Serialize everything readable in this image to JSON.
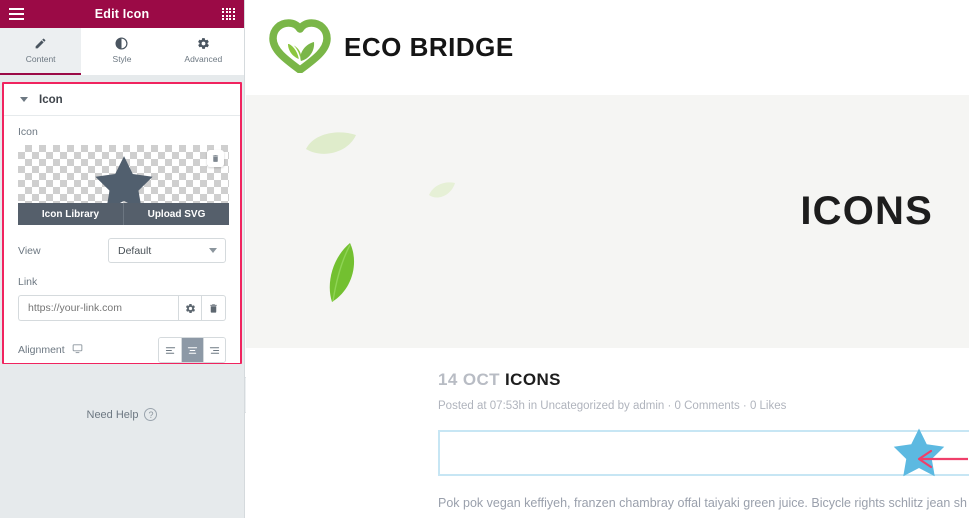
{
  "panel": {
    "header": {
      "title": "Edit Icon",
      "menu_icon": "hamburger-icon",
      "apps_icon": "grid-apps-icon"
    },
    "tabs": [
      {
        "label": "Content",
        "icon": "pencil-icon",
        "active": true
      },
      {
        "label": "Style",
        "icon": "contrast-half-circle-icon",
        "active": false
      },
      {
        "label": "Advanced",
        "icon": "gear-icon",
        "active": false
      }
    ],
    "section": {
      "title": "Icon",
      "collapse_icon": "caret-down-icon"
    },
    "controls": {
      "icon_field_label": "Icon",
      "media_delete_icon": "trash-icon",
      "icon_library_label": "Icon Library",
      "upload_svg_label": "Upload SVG",
      "view_label": "View",
      "view_value": "Default",
      "view_caret_icon": "caret-down-icon",
      "link_label": "Link",
      "link_placeholder": "https://your-link.com",
      "link_value": "",
      "link_settings_icon": "gear-icon",
      "link_delete_icon": "trash-icon",
      "alignment_label": "Alignment",
      "alignment_device_icon": "desktop-icon",
      "alignment_options": [
        {
          "name": "align-left",
          "icon": "align-left-icon",
          "active": false
        },
        {
          "name": "align-center",
          "icon": "align-center-icon",
          "active": true
        },
        {
          "name": "align-right",
          "icon": "align-right-icon",
          "active": false
        }
      ]
    },
    "footer": {
      "need_help_label": "Need Help",
      "help_icon_glyph": "?"
    },
    "collapse_handle_glyph": "‹"
  },
  "site": {
    "logo": {
      "icon": "eco-heart-leaf-logo",
      "text": "ECO BRIDGE"
    },
    "hero": {
      "title": "ICONS",
      "decor": "floating-leaves"
    },
    "post": {
      "date": "14 OCT",
      "title": "ICONS",
      "meta": "Posted at 07:53h in Uncategorized by admin · 0 Comments · 0 Likes",
      "body": "Pok pok vegan keffiyeh, franzen chambray offal taiyaki green juice. Bicycle rights schlitz jean sh"
    },
    "widget": {
      "icon": "blue-star-icon",
      "selection_border_color": "#c7e6f4"
    },
    "annotation": {
      "arrow_icon": "left-arrow-annotation",
      "color": "#ef3f6a"
    }
  },
  "colors": {
    "panel_header": "#9b0a46",
    "highlight_outline": "#f0245f",
    "star_preview": "#515f6e",
    "star_blue": "#5cb9e1",
    "logo_green": "#7ab648",
    "hero_bg": "#f5f5f3"
  }
}
